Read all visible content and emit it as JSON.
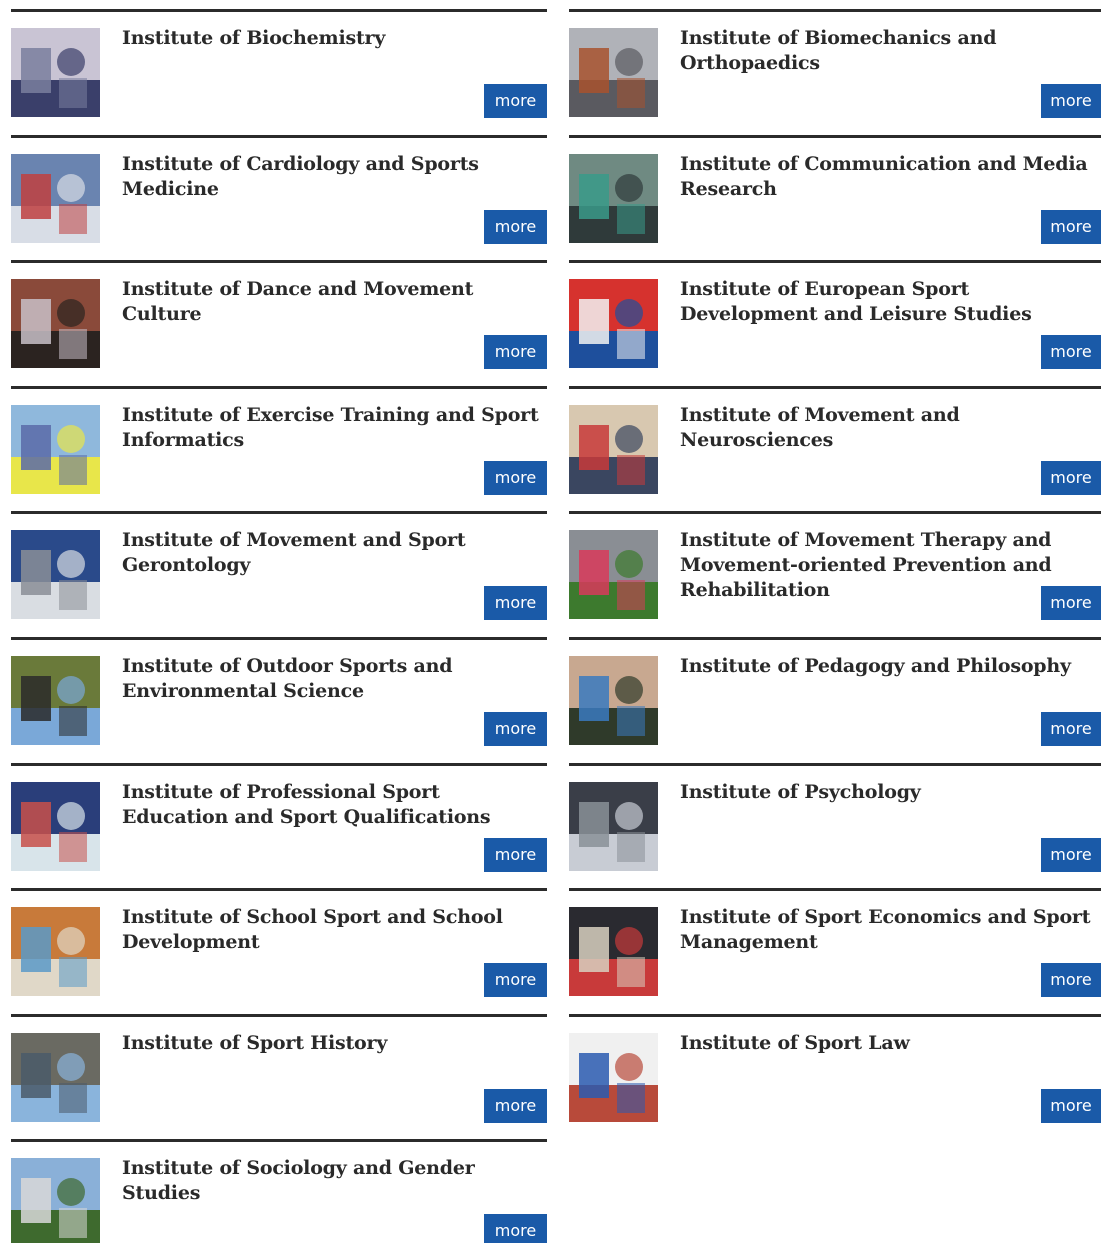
{
  "institutes": [
    {
      "name": "Institute of Biochemistry",
      "more_label": "more",
      "thumb_icon": "lab-vials-icon",
      "colors": [
        "#3a3f6a",
        "#c9c4d4",
        "#7a7f9e"
      ]
    },
    {
      "name": "Institute of Biomechanics and Orthopaedics",
      "more_label": "more",
      "thumb_icon": "lab-equipment-icon",
      "colors": [
        "#5a5a60",
        "#b0b2b8",
        "#a8522e"
      ]
    },
    {
      "name": "Institute of Cardiology and Sports Medicine",
      "more_label": "more",
      "thumb_icon": "medical-exam-icon",
      "colors": [
        "#d8dde6",
        "#6a84b0",
        "#c04040"
      ]
    },
    {
      "name": "Institute of Communication and Media Research",
      "more_label": "more",
      "thumb_icon": "camera-studio-icon",
      "colors": [
        "#2f3a3a",
        "#6f8a82",
        "#3a9a8a"
      ]
    },
    {
      "name": "Institute of Dance and Movement Culture",
      "more_label": "more",
      "thumb_icon": "dancer-icon",
      "colors": [
        "#2b2320",
        "#8a4a3a",
        "#c8c0c8"
      ]
    },
    {
      "name": "Institute of European Sport Development and Leisure Studies",
      "more_label": "more",
      "thumb_icon": "flags-icon",
      "colors": [
        "#1e4f9c",
        "#d6322e",
        "#f2f2f2"
      ]
    },
    {
      "name": "Institute of Exercise Training and Sport Informatics",
      "more_label": "more",
      "thumb_icon": "tactics-map-icon",
      "colors": [
        "#e8e64a",
        "#8fb8dc",
        "#5a6aa8"
      ]
    },
    {
      "name": "Institute of Movement and Neurosciences",
      "more_label": "more",
      "thumb_icon": "eeg-lab-icon",
      "colors": [
        "#3a4660",
        "#d8c8b0",
        "#c83a3a"
      ]
    },
    {
      "name": "Institute of Movement and Sport Gerontology",
      "more_label": "more",
      "thumb_icon": "fitness-senior-icon",
      "colors": [
        "#d9dde2",
        "#2a4a8a",
        "#8a8e96"
      ]
    },
    {
      "name": "Institute of Movement Therapy and Movement-oriented Prevention and Rehabilitation",
      "more_label": "more",
      "thumb_icon": "runners-icon",
      "colors": [
        "#3d7a2e",
        "#8a8e94",
        "#d83a5a"
      ]
    },
    {
      "name": "Institute of Outdoor Sports and Environmental Science",
      "more_label": "more",
      "thumb_icon": "climber-icon",
      "colors": [
        "#7aa8d8",
        "#6a7a3a",
        "#2a2a2a"
      ]
    },
    {
      "name": "Institute of Pedagogy and Philosophy",
      "more_label": "more",
      "thumb_icon": "athletes-icon",
      "colors": [
        "#2f3a2a",
        "#c8a890",
        "#3a7ac0"
      ]
    },
    {
      "name": "Institute of Professional Sport Education and Sport Qualifications",
      "more_label": "more",
      "thumb_icon": "coach-icon",
      "colors": [
        "#d8e4ea",
        "#2a3e7a",
        "#c8504a"
      ]
    },
    {
      "name": "Institute of Psychology",
      "more_label": "more",
      "thumb_icon": "building-icon",
      "colors": [
        "#c8ccd4",
        "#3a3e48",
        "#8a9098"
      ]
    },
    {
      "name": "Institute of School Sport and School Development",
      "more_label": "more",
      "thumb_icon": "gym-hall-icon",
      "colors": [
        "#e0d8c8",
        "#c87a3a",
        "#5a9ac8"
      ]
    },
    {
      "name": "Institute of Sport Economics and Sport Management",
      "more_label": "more",
      "thumb_icon": "stadium-crowd-icon",
      "colors": [
        "#c83a3a",
        "#2a2a30",
        "#d8d0c0"
      ]
    },
    {
      "name": "Institute of Sport History",
      "more_label": "more",
      "thumb_icon": "tower-bridge-icon",
      "colors": [
        "#8ab4dc",
        "#6a6a62",
        "#4a5a6a"
      ]
    },
    {
      "name": "Institute of Sport Law",
      "more_label": "more",
      "thumb_icon": "running-track-icon",
      "colors": [
        "#b84a3a",
        "#f0f0f0",
        "#2a5ab0"
      ]
    },
    {
      "name": "Institute of Sociology and Gender Studies",
      "more_label": "more",
      "thumb_icon": "campus-trees-icon",
      "colors": [
        "#3e6a2e",
        "#8ab0d8",
        "#d8d8d8"
      ]
    }
  ]
}
